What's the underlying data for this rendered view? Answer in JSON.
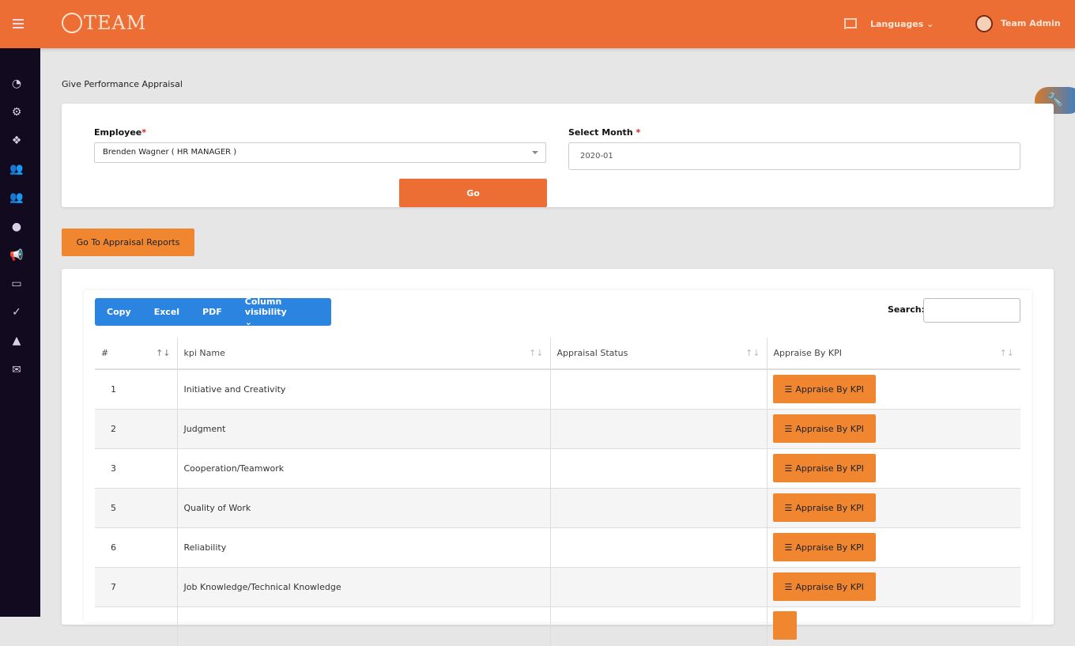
{
  "header": {
    "logo": "TEAM",
    "languages": "Languages",
    "user": "Team Admin"
  },
  "sidebar": {
    "icons": [
      "dashboard-icon",
      "settings-icon",
      "boxes-icon",
      "users-icon",
      "team-icon",
      "user-icon",
      "megaphone-icon",
      "ticket-icon",
      "check-circle-icon",
      "spy-icon",
      "mail-icon"
    ]
  },
  "page": {
    "title": "Give Performance Appraisal"
  },
  "form": {
    "employee_label": "Employee",
    "employee_value": "Brenden Wagner ( HR MANAGER )",
    "month_label": "Select Month",
    "month_value": "2020-01",
    "go": "Go"
  },
  "reports_button": "Go To Appraisal Reports",
  "toolbar": {
    "copy": "Copy",
    "excel": "Excel",
    "pdf": "PDF",
    "colvis": "Column visibility",
    "search_label": "Search:"
  },
  "table": {
    "headers": [
      "#",
      "kpi Name",
      "Appraisal Status",
      "Appraise By KPI"
    ],
    "rows": [
      {
        "n": "1",
        "name": "Initiative and Creativity"
      },
      {
        "n": "2",
        "name": "Judgment"
      },
      {
        "n": "3",
        "name": "Cooperation/Teamwork"
      },
      {
        "n": "5",
        "name": "Quality of Work"
      },
      {
        "n": "6",
        "name": "Reliability"
      },
      {
        "n": "7",
        "name": "Job Knowledge/Technical Knowledge"
      }
    ],
    "action_label": "Appraise By KPI"
  }
}
